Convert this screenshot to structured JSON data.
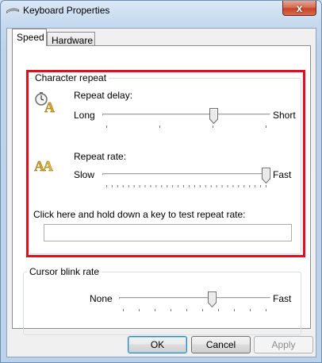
{
  "window": {
    "title": "Keyboard Properties",
    "close_glyph": "x"
  },
  "tabs": [
    {
      "label": "Speed",
      "selected": true
    },
    {
      "label": "Hardware",
      "selected": false
    }
  ],
  "character_repeat": {
    "group_label": "Character repeat",
    "repeat_delay": {
      "label": "Repeat delay:",
      "min_label": "Long",
      "max_label": "Short",
      "level": 0.67,
      "tick_count": 4
    },
    "repeat_rate": {
      "label": "Repeat rate:",
      "min_label": "Slow",
      "max_label": "Fast",
      "level": 1.0,
      "tick_count": 30
    },
    "test_label": "Click here and hold down a key to test repeat rate:",
    "test_value": ""
  },
  "cursor_blink": {
    "group_label": "Cursor blink rate",
    "min_label": "None",
    "max_label": "Fast",
    "level": 0.62,
    "tick_count": 10
  },
  "buttons": {
    "ok": "OK",
    "cancel": "Cancel",
    "apply": "Apply"
  },
  "colors": {
    "highlight": "#e0101e",
    "icon_gold": "#d9a520",
    "window_frame": "#bcd2ea"
  }
}
